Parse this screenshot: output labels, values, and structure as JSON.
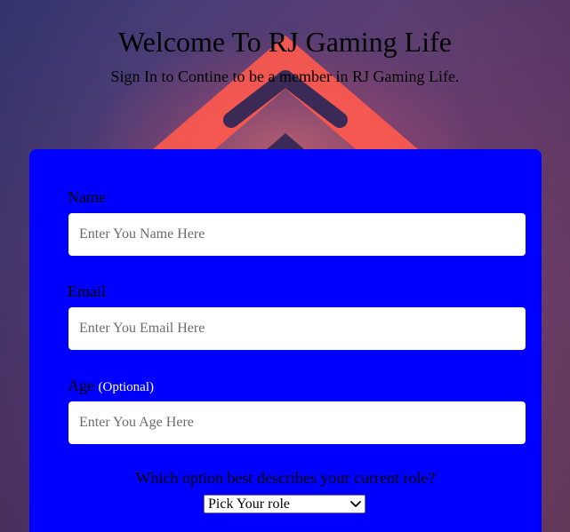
{
  "header": {
    "title": "Welcome To RJ Gaming Life",
    "subtitle": "Sign In to Contine to be a member in RJ Gaming Life."
  },
  "form": {
    "name": {
      "label": "Name",
      "placeholder": "Enter You Name Here",
      "value": ""
    },
    "email": {
      "label": "Email",
      "placeholder": "Enter You Email Here",
      "value": ""
    },
    "age": {
      "label": "Age",
      "optional_note": "(Optional)",
      "placeholder": "Enter You Age Here",
      "value": ""
    },
    "role": {
      "question": "Which option best describes your current role?",
      "selected": "Pick Your role"
    }
  },
  "icons": {
    "background_logo": "chevron-up-logo-icon",
    "select_arrow": "chevron-down-icon"
  },
  "colors": {
    "form_background": "#0000ff",
    "input_background": "#ffffff",
    "background_gradient_start": "#3a3c7a",
    "background_gradient_end": "#8a4a6a",
    "logo_red": "#ff5a4e"
  }
}
